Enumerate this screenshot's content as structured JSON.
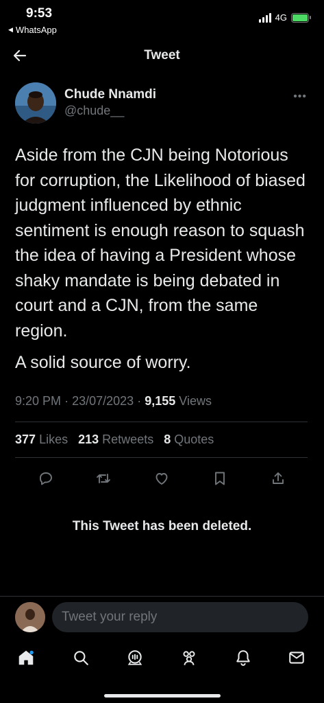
{
  "status_bar": {
    "time": "9:53",
    "back_app": "WhatsApp",
    "network": "4G"
  },
  "header": {
    "title": "Tweet"
  },
  "tweet": {
    "author_name": "Chude Nnamdi",
    "author_handle": "@chude__",
    "paragraphs": [
      "Aside from the CJN being Notorious for corruption, the Likelihood of biased judgment influenced by ethnic sentiment is enough reason to squash the idea of having a President whose shaky mandate is being debated in court and a CJN, from the same region.",
      "A solid source of worry."
    ],
    "time": "9:20 PM",
    "date": "23/07/2023",
    "views_count": "9,155",
    "views_label": "Views",
    "separator": "·",
    "likes_count": "377",
    "likes_label": "Likes",
    "retweets_count": "213",
    "retweets_label": "Retweets",
    "quotes_count": "8",
    "quotes_label": "Quotes"
  },
  "deleted_notice": "This Tweet has been deleted.",
  "reply": {
    "placeholder": "Tweet your reply"
  },
  "icons": {
    "actions": [
      "reply-icon",
      "retweet-icon",
      "like-icon",
      "bookmark-icon",
      "share-icon"
    ],
    "tabs": [
      "home-icon",
      "search-icon",
      "spaces-icon",
      "communities-icon",
      "notifications-icon",
      "messages-icon"
    ]
  },
  "colors": {
    "background": "#000000",
    "text": "#e7e9ea",
    "secondary": "#71767b",
    "divider": "#2f3336",
    "battery": "#4cd964"
  }
}
